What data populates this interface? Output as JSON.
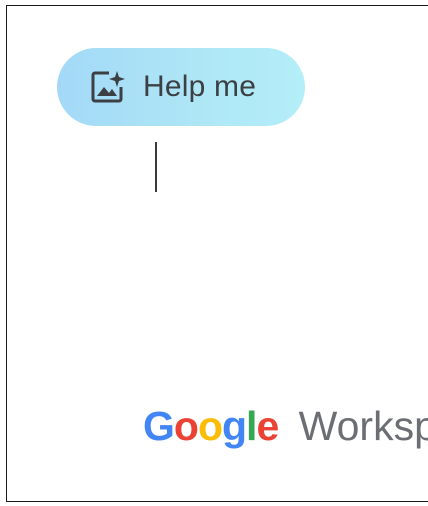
{
  "help_button": {
    "label": "Help me",
    "icon": "image-sparkle-icon"
  },
  "branding": {
    "google_letters": [
      "G",
      "o",
      "o",
      "g",
      "l",
      "e"
    ],
    "product": "Workspa"
  },
  "colors": {
    "pill_gradient_start": "#a3d9f7",
    "pill_gradient_end": "#b4eef8",
    "text_dark": "#3c3f44",
    "google_blue": "#4285F4",
    "google_red": "#EA4335",
    "google_yellow": "#FBBC05",
    "google_green": "#34A853",
    "workspace_gray": "#6b6e72"
  }
}
